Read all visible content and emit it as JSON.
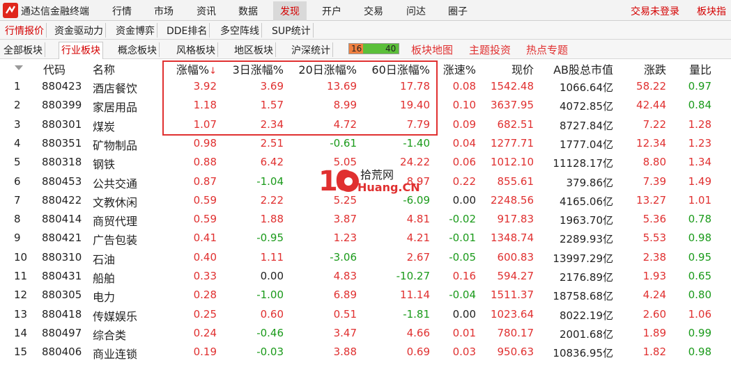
{
  "app": {
    "title": "通达信金融终端"
  },
  "menu": {
    "items": [
      "行情",
      "市场",
      "资讯",
      "数据",
      "发现",
      "开户",
      "交易",
      "问达",
      "圈子"
    ],
    "active": "发现",
    "right_items": [
      "交易未登录",
      "板块指"
    ]
  },
  "tabs1": [
    "行情报价",
    "资金驱动力",
    "资金博弈",
    "DDE排名",
    "多空阵线",
    "SUP统计"
  ],
  "tabs1_active": "行情报价",
  "tabs2": [
    "全部板块",
    "行业板块",
    "概念板块",
    "风格板块",
    "地区板块",
    "沪深统计"
  ],
  "tabs2_active": "行业板块",
  "ratio": {
    "up": "16",
    "down": "40",
    "up_fraction": 0.2857
  },
  "links": [
    "板块地图",
    "主题投资",
    "热点专题"
  ],
  "columns": {
    "code": "代码",
    "name": "名称",
    "chg": "涨幅%",
    "chg3": "3日涨幅%",
    "chg20": "20日涨幅%",
    "chg60": "60日涨幅%",
    "speed": "涨速%",
    "price": "现价",
    "mktcap": "AB股总市值",
    "change": "涨跌",
    "vol_ratio": "量比"
  },
  "sort_arrow": "↓",
  "rows": [
    {
      "idx": "1",
      "code": "880423",
      "name": "酒店餐饮",
      "chg": "3.92",
      "chg3": "3.69",
      "chg20": "13.69",
      "chg60": "17.78",
      "speed": "0.08",
      "price": "1542.48",
      "mktcap": "1066.64亿",
      "change": "58.22",
      "vol_ratio": "0.97"
    },
    {
      "idx": "2",
      "code": "880399",
      "name": "家居用品",
      "chg": "1.18",
      "chg3": "1.57",
      "chg20": "8.99",
      "chg60": "19.40",
      "speed": "0.10",
      "price": "3637.95",
      "mktcap": "4072.85亿",
      "change": "42.44",
      "vol_ratio": "0.84"
    },
    {
      "idx": "3",
      "code": "880301",
      "name": "煤炭",
      "chg": "1.07",
      "chg3": "2.34",
      "chg20": "4.72",
      "chg60": "7.79",
      "speed": "0.09",
      "price": "682.51",
      "mktcap": "8727.84亿",
      "change": "7.22",
      "vol_ratio": "1.28"
    },
    {
      "idx": "4",
      "code": "880351",
      "name": "矿物制品",
      "chg": "0.98",
      "chg3": "2.51",
      "chg20": "-0.61",
      "chg60": "-1.40",
      "speed": "0.04",
      "price": "1277.71",
      "mktcap": "1777.04亿",
      "change": "12.34",
      "vol_ratio": "1.23"
    },
    {
      "idx": "5",
      "code": "880318",
      "name": "钢铁",
      "chg": "0.88",
      "chg3": "6.42",
      "chg20": "5.05",
      "chg60": "24.22",
      "speed": "0.06",
      "price": "1012.10",
      "mktcap": "11128.17亿",
      "change": "8.80",
      "vol_ratio": "1.34"
    },
    {
      "idx": "6",
      "code": "880453",
      "name": "公共交通",
      "chg": "0.87",
      "chg3": "-1.04",
      "chg20": "",
      "chg60": "8.97",
      "speed": "0.22",
      "price": "855.61",
      "mktcap": "379.86亿",
      "change": "7.39",
      "vol_ratio": "1.49"
    },
    {
      "idx": "7",
      "code": "880422",
      "name": "文教休闲",
      "chg": "0.59",
      "chg3": "2.22",
      "chg20": "5.25",
      "chg60": "-6.09",
      "speed": "0.00",
      "price": "2248.56",
      "mktcap": "4165.06亿",
      "change": "13.27",
      "vol_ratio": "1.01"
    },
    {
      "idx": "8",
      "code": "880414",
      "name": "商贸代理",
      "chg": "0.59",
      "chg3": "1.88",
      "chg20": "3.87",
      "chg60": "4.81",
      "speed": "-0.02",
      "price": "917.83",
      "mktcap": "1963.70亿",
      "change": "5.36",
      "vol_ratio": "0.78"
    },
    {
      "idx": "9",
      "code": "880421",
      "name": "广告包装",
      "chg": "0.41",
      "chg3": "-0.95",
      "chg20": "1.23",
      "chg60": "4.21",
      "speed": "-0.01",
      "price": "1348.74",
      "mktcap": "2289.93亿",
      "change": "5.53",
      "vol_ratio": "0.98"
    },
    {
      "idx": "10",
      "code": "880310",
      "name": "石油",
      "chg": "0.40",
      "chg3": "1.11",
      "chg20": "-3.06",
      "chg60": "2.67",
      "speed": "-0.05",
      "price": "600.83",
      "mktcap": "13997.29亿",
      "change": "2.38",
      "vol_ratio": "0.95"
    },
    {
      "idx": "11",
      "code": "880431",
      "name": "船舶",
      "chg": "0.33",
      "chg3": "0.00",
      "chg20": "4.83",
      "chg60": "-10.27",
      "speed": "0.16",
      "price": "594.27",
      "mktcap": "2176.89亿",
      "change": "1.93",
      "vol_ratio": "0.65"
    },
    {
      "idx": "12",
      "code": "880305",
      "name": "电力",
      "chg": "0.28",
      "chg3": "-1.00",
      "chg20": "6.89",
      "chg60": "11.14",
      "speed": "-0.04",
      "price": "1511.37",
      "mktcap": "18758.68亿",
      "change": "4.24",
      "vol_ratio": "0.80"
    },
    {
      "idx": "13",
      "code": "880418",
      "name": "传媒娱乐",
      "chg": "0.25",
      "chg3": "0.60",
      "chg20": "0.51",
      "chg60": "-1.81",
      "speed": "0.00",
      "price": "1023.64",
      "mktcap": "8022.19亿",
      "change": "2.60",
      "vol_ratio": "1.06"
    },
    {
      "idx": "14",
      "code": "880497",
      "name": "综合类",
      "chg": "0.24",
      "chg3": "-0.46",
      "chg20": "3.47",
      "chg60": "4.66",
      "speed": "0.01",
      "price": "780.17",
      "mktcap": "2001.68亿",
      "change": "1.89",
      "vol_ratio": "0.99"
    },
    {
      "idx": "15",
      "code": "880406",
      "name": "商业连锁",
      "chg": "0.19",
      "chg3": "-0.03",
      "chg20": "3.88",
      "chg60": "0.69",
      "speed": "0.03",
      "price": "950.63",
      "mktcap": "10836.95亿",
      "change": "1.82",
      "vol_ratio": "0.98"
    }
  ],
  "watermark": {
    "digits": "10",
    "cn": "拾荒网",
    "en": "Huang.CN"
  },
  "colors": {
    "up": "#e03030",
    "down": "#1a9a1a",
    "accent": "#d40000"
  }
}
